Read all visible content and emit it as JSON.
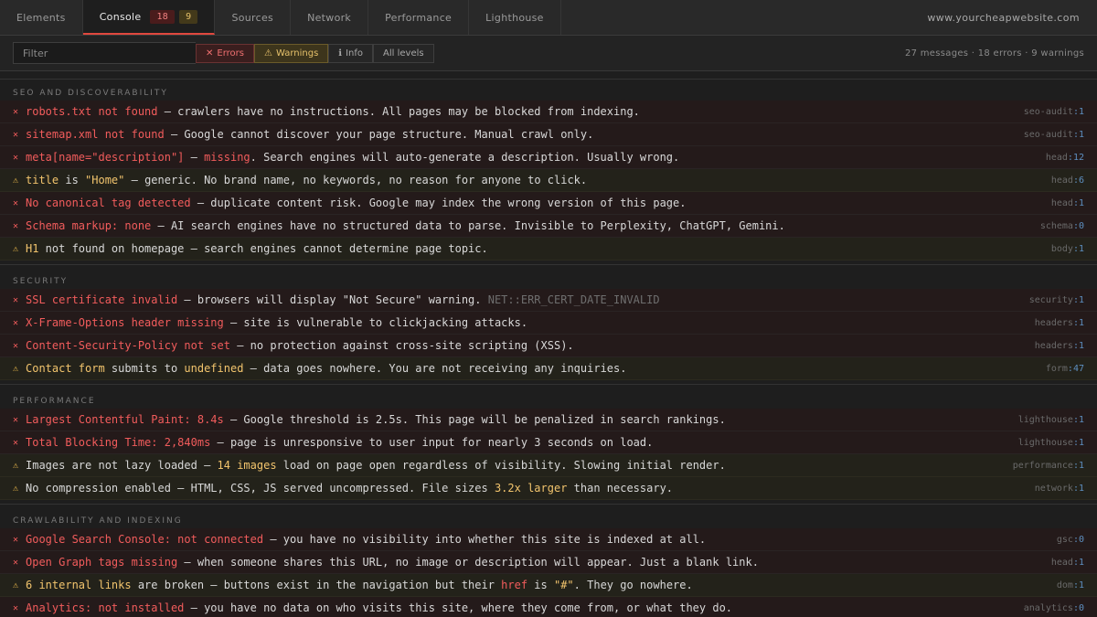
{
  "tabs": [
    {
      "label": "Elements"
    },
    {
      "label": "Console",
      "error_count": "18",
      "warning_count": "9"
    },
    {
      "label": "Sources"
    },
    {
      "label": "Network"
    },
    {
      "label": "Performance"
    },
    {
      "label": "Lighthouse"
    }
  ],
  "site_url": "www.yourcheapwebsite.com",
  "filter": {
    "placeholder": "Filter",
    "value": "",
    "levels": [
      {
        "icon": "✕",
        "label": "Errors"
      },
      {
        "icon": "⚠",
        "label": "Warnings"
      },
      {
        "icon": "ℹ",
        "label": "Info"
      },
      {
        "icon": "",
        "label": "All levels"
      }
    ],
    "summary": "27 messages · 18 errors · 9 warnings"
  },
  "colors": {
    "error": "#f25c5c",
    "warning": "#f2c46d",
    "accent": "#e0483e",
    "line_number": "#5d8fc0"
  },
  "sections": [
    {
      "title": "SEO AND DISCOVERABILITY",
      "rows": [
        {
          "level": "error",
          "parts": [
            {
              "s": "e",
              "t": "robots.txt not found"
            },
            {
              "s": "",
              "t": " — crawlers have no instructions. All pages may be blocked from indexing."
            }
          ],
          "source": "seo-audit",
          "line": "1"
        },
        {
          "level": "error",
          "parts": [
            {
              "s": "e",
              "t": "sitemap.xml not found"
            },
            {
              "s": "",
              "t": " — Google cannot discover your page structure. Manual crawl only."
            }
          ],
          "source": "seo-audit",
          "line": "1"
        },
        {
          "level": "error",
          "parts": [
            {
              "s": "e",
              "t": "meta[name=\"description\"]"
            },
            {
              "s": "",
              "t": " — "
            },
            {
              "s": "e",
              "t": "missing"
            },
            {
              "s": "",
              "t": ". Search engines will auto-generate a description. Usually wrong."
            }
          ],
          "source": "head",
          "line": "12"
        },
        {
          "level": "warning",
          "parts": [
            {
              "s": "w",
              "t": "title"
            },
            {
              "s": "",
              "t": " is "
            },
            {
              "s": "w",
              "t": "\"Home\""
            },
            {
              "s": "",
              "t": " — generic. No brand name, no keywords, no reason for anyone to click."
            }
          ],
          "source": "head",
          "line": "6"
        },
        {
          "level": "error",
          "parts": [
            {
              "s": "e",
              "t": "No canonical tag detected"
            },
            {
              "s": "",
              "t": " — duplicate content risk. Google may index the wrong version of this page."
            }
          ],
          "source": "head",
          "line": "1"
        },
        {
          "level": "error",
          "parts": [
            {
              "s": "e",
              "t": "Schema markup: none"
            },
            {
              "s": "",
              "t": " — AI search engines have no structured data to parse. Invisible to Perplexity, ChatGPT, Gemini."
            }
          ],
          "source": "schema",
          "line": "0"
        },
        {
          "level": "warning",
          "parts": [
            {
              "s": "w",
              "t": "H1"
            },
            {
              "s": "",
              "t": " not found on homepage — search engines cannot determine page topic."
            }
          ],
          "source": "body",
          "line": "1"
        }
      ]
    },
    {
      "title": "SECURITY",
      "rows": [
        {
          "level": "error",
          "parts": [
            {
              "s": "e",
              "t": "SSL certificate invalid"
            },
            {
              "s": "",
              "t": " — browsers will display \"Not Secure\" warning. "
            },
            {
              "s": "dim",
              "t": "NET::ERR_CERT_DATE_INVALID"
            }
          ],
          "source": "security",
          "line": "1"
        },
        {
          "level": "error",
          "parts": [
            {
              "s": "e",
              "t": "X-Frame-Options header missing"
            },
            {
              "s": "",
              "t": " — site is vulnerable to clickjacking attacks."
            }
          ],
          "source": "headers",
          "line": "1"
        },
        {
          "level": "error",
          "parts": [
            {
              "s": "e",
              "t": "Content-Security-Policy not set"
            },
            {
              "s": "",
              "t": " — no protection against cross-site scripting (XSS)."
            }
          ],
          "source": "headers",
          "line": "1"
        },
        {
          "level": "warning",
          "parts": [
            {
              "s": "w",
              "t": "Contact form"
            },
            {
              "s": "",
              "t": " submits to "
            },
            {
              "s": "w",
              "t": "undefined"
            },
            {
              "s": "",
              "t": " — data goes nowhere. You are not receiving any inquiries."
            }
          ],
          "source": "form",
          "line": "47"
        }
      ]
    },
    {
      "title": "PERFORMANCE",
      "rows": [
        {
          "level": "error",
          "parts": [
            {
              "s": "e",
              "t": "Largest Contentful Paint: 8.4s"
            },
            {
              "s": "",
              "t": " — Google threshold is 2.5s. This page will be penalized in search rankings."
            }
          ],
          "source": "lighthouse",
          "line": "1"
        },
        {
          "level": "error",
          "parts": [
            {
              "s": "e",
              "t": "Total Blocking Time: 2,840ms"
            },
            {
              "s": "",
              "t": " — page is unresponsive to user input for nearly 3 seconds on load."
            }
          ],
          "source": "lighthouse",
          "line": "1"
        },
        {
          "level": "warning",
          "parts": [
            {
              "s": "",
              "t": "Images are not lazy loaded — "
            },
            {
              "s": "w",
              "t": "14 images"
            },
            {
              "s": "",
              "t": " load on page open regardless of visibility. Slowing initial render."
            }
          ],
          "source": "performance",
          "line": "1"
        },
        {
          "level": "warning",
          "parts": [
            {
              "s": "",
              "t": "No compression enabled — HTML, CSS, JS served uncompressed. File sizes "
            },
            {
              "s": "w",
              "t": "3.2x larger"
            },
            {
              "s": "",
              "t": " than necessary."
            }
          ],
          "source": "network",
          "line": "1"
        }
      ]
    },
    {
      "title": "CRAWLABILITY AND INDEXING",
      "rows": [
        {
          "level": "error",
          "parts": [
            {
              "s": "e",
              "t": "Google Search Console: not connected"
            },
            {
              "s": "",
              "t": " — you have no visibility into whether this site is indexed at all."
            }
          ],
          "source": "gsc",
          "line": "0"
        },
        {
          "level": "error",
          "parts": [
            {
              "s": "e",
              "t": "Open Graph tags missing"
            },
            {
              "s": "",
              "t": " — when someone shares this URL, no image or description will appear. Just a blank link."
            }
          ],
          "source": "head",
          "line": "1"
        },
        {
          "level": "warning",
          "parts": [
            {
              "s": "w",
              "t": "6 internal links"
            },
            {
              "s": "",
              "t": " are broken — buttons exist in the navigation but their "
            },
            {
              "s": "e",
              "t": "href"
            },
            {
              "s": "",
              "t": " is "
            },
            {
              "s": "w",
              "t": "\"#\""
            },
            {
              "s": "",
              "t": ". They go nowhere."
            }
          ],
          "source": "dom",
          "line": "1"
        },
        {
          "level": "error",
          "parts": [
            {
              "s": "e",
              "t": "Analytics: not installed"
            },
            {
              "s": "",
              "t": " — you have no data on who visits this site, where they come from, or what they do."
            }
          ],
          "source": "analytics",
          "line": "0"
        }
      ]
    }
  ]
}
